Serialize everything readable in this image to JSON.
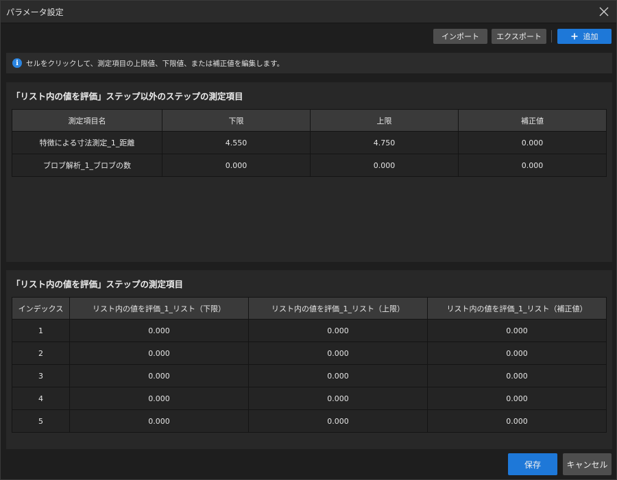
{
  "window": {
    "title": "パラメータ設定"
  },
  "toolbar": {
    "import_label": "インポート",
    "export_label": "エクスポート",
    "add_label": "追加"
  },
  "info": {
    "text": "セルをクリックして、測定項目の上限値、下限値、または補正値を編集します。"
  },
  "section1": {
    "title": "「リスト内の値を評価」ステップ以外のステップの測定項目",
    "headers": [
      "測定項目名",
      "下限",
      "上限",
      "補正値"
    ],
    "rows": [
      [
        "特徴による寸法測定_1_距離",
        "4.550",
        "4.750",
        "0.000"
      ],
      [
        "ブロブ解析_1_ブロブの数",
        "0.000",
        "0.000",
        "0.000"
      ]
    ]
  },
  "section2": {
    "title": "「リスト内の値を評価」ステップの測定項目",
    "headers": [
      "インデックス",
      "リスト内の値を評価_1_リスト（下限）",
      "リスト内の値を評価_1_リスト（上限）",
      "リスト内の値を評価_1_リスト（補正値）"
    ],
    "rows": [
      [
        "1",
        "0.000",
        "0.000",
        "0.000"
      ],
      [
        "2",
        "0.000",
        "0.000",
        "0.000"
      ],
      [
        "3",
        "0.000",
        "0.000",
        "0.000"
      ],
      [
        "4",
        "0.000",
        "0.000",
        "0.000"
      ],
      [
        "5",
        "0.000",
        "0.000",
        "0.000"
      ]
    ]
  },
  "footer": {
    "save_label": "保存",
    "cancel_label": "キャンセル"
  },
  "icons": {
    "close": "close-icon",
    "info": "info-icon",
    "add": "plus-icon"
  },
  "colors": {
    "accent": "#1e78d8",
    "background": "#1e1e1e",
    "panel": "#282828"
  }
}
